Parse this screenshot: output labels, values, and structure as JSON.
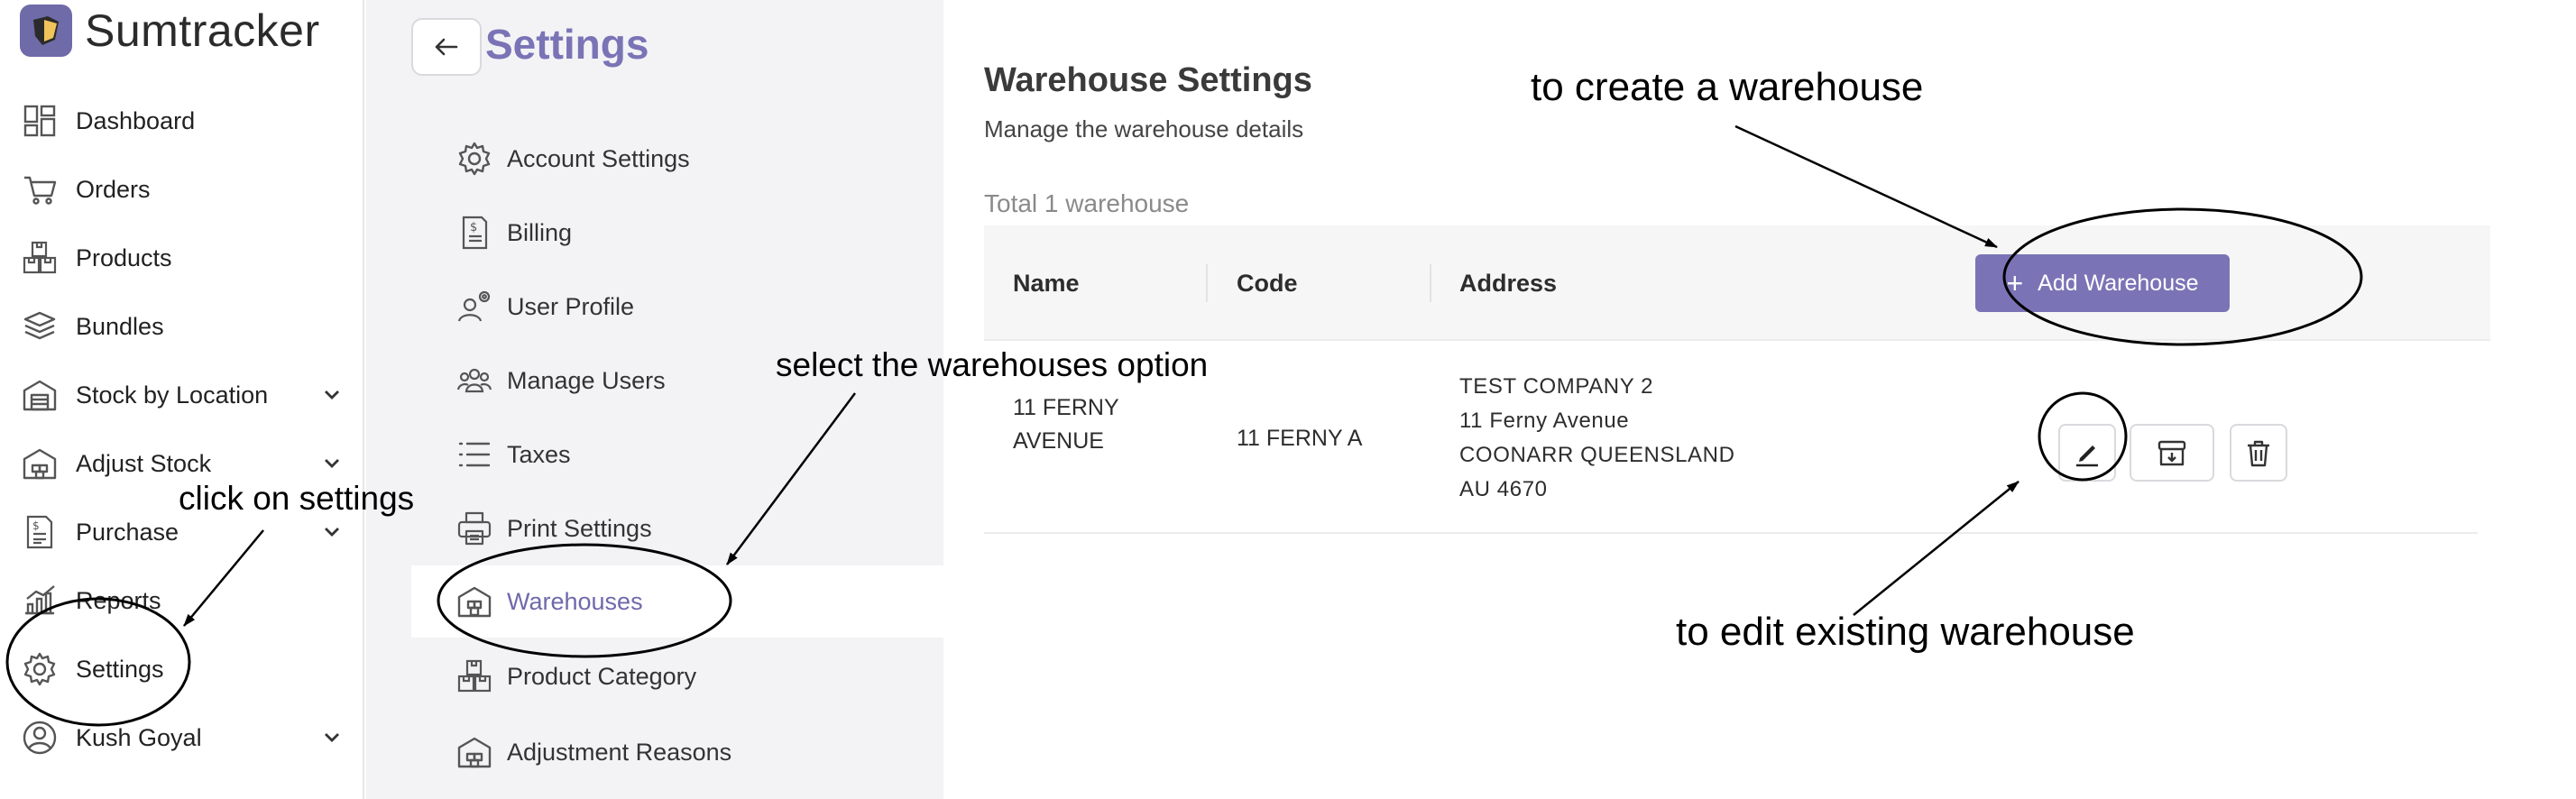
{
  "brand": {
    "name": "Sumtracker"
  },
  "sidebar": {
    "items": [
      {
        "label": "Dashboard",
        "icon": "dashboard-icon"
      },
      {
        "label": "Orders",
        "icon": "cart-icon"
      },
      {
        "label": "Products",
        "icon": "boxes-icon"
      },
      {
        "label": "Bundles",
        "icon": "layers-icon"
      },
      {
        "label": "Stock by Location",
        "icon": "warehouse-icon",
        "expandable": true
      },
      {
        "label": "Adjust Stock",
        "icon": "warehouse-adjust-icon",
        "expandable": true
      },
      {
        "label": "Purchase",
        "icon": "invoice-icon",
        "expandable": true
      },
      {
        "label": "Reports",
        "icon": "chart-icon"
      },
      {
        "label": "Settings",
        "icon": "gear-icon"
      },
      {
        "label": "Kush Goyal",
        "icon": "user-circle-icon",
        "expandable": true
      }
    ]
  },
  "settings": {
    "title": "Settings",
    "menu": [
      {
        "label": "Account Settings",
        "icon": "gear-icon"
      },
      {
        "label": "Billing",
        "icon": "bill-icon"
      },
      {
        "label": "User Profile",
        "icon": "user-gear-icon"
      },
      {
        "label": "Manage Users",
        "icon": "users-icon"
      },
      {
        "label": "Taxes",
        "icon": "list-icon"
      },
      {
        "label": "Print Settings",
        "icon": "printer-icon"
      },
      {
        "label": "Warehouses",
        "icon": "warehouse-icon",
        "active": true
      },
      {
        "label": "Product Category",
        "icon": "boxes-icon"
      },
      {
        "label": "Adjustment Reasons",
        "icon": "warehouse-adjust-icon"
      }
    ]
  },
  "main": {
    "title": "Warehouse Settings",
    "subtitle": "Manage the warehouse details",
    "total": "Total 1 warehouse",
    "columns": {
      "name": "Name",
      "code": "Code",
      "address": "Address"
    },
    "add_button": "Add Warehouse",
    "rows": [
      {
        "name_line1": "11 FERNY",
        "name_line2": "AVENUE",
        "code": "11 FERNY A",
        "address_lines": [
          "TEST COMPANY 2",
          "11 Ferny Avenue",
          "COONARR QUEENSLAND",
          "AU 4670"
        ]
      }
    ]
  },
  "annotations": {
    "create": "to create a warehouse",
    "select": "select the warehouses option",
    "settings": "click on settings",
    "edit": "to edit existing warehouse"
  },
  "colors": {
    "accent": "#7a74b6",
    "panel_bg": "#f3f3f6",
    "active_text": "#6f69ab"
  }
}
